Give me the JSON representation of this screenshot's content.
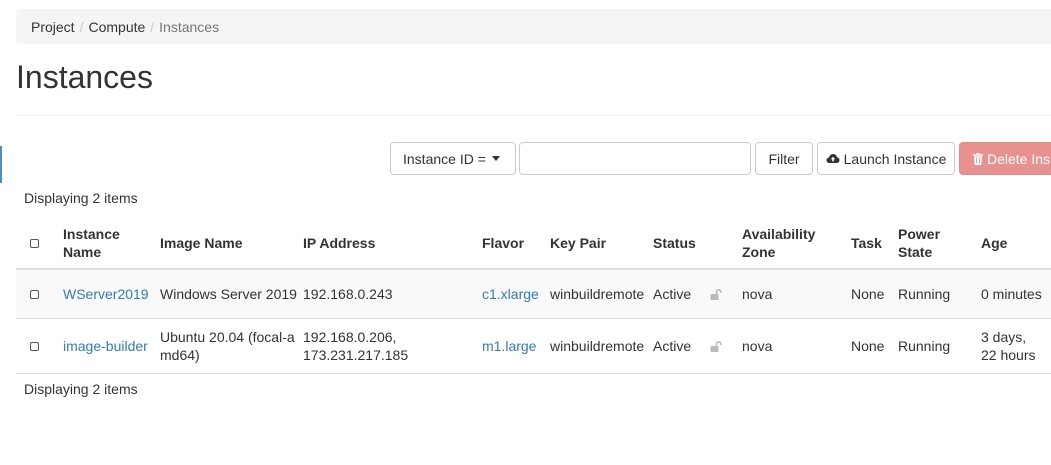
{
  "breadcrumb": {
    "items": [
      "Project",
      "Compute"
    ],
    "separator": "/",
    "current": "Instances"
  },
  "page": {
    "title": "Instances"
  },
  "toolbar": {
    "filter_select_label": "Instance ID =",
    "filter_input_value": "",
    "filter_button": "Filter",
    "launch_button": "Launch Instance",
    "delete_button": "Delete Ins"
  },
  "table": {
    "count_label": "Displaying 2 items",
    "headers": {
      "instance_name": [
        "Instance",
        "Name"
      ],
      "image_name": "Image Name",
      "ip_address": "IP Address",
      "flavor": "Flavor",
      "key_pair": "Key Pair",
      "status": "Status",
      "availability_zone": [
        "Availability",
        "Zone"
      ],
      "task": "Task",
      "power_state": [
        "Power",
        "State"
      ],
      "age": "Age"
    },
    "rows": [
      {
        "instance_name": "WServer2019",
        "image_name": [
          "Windows Server 2019"
        ],
        "ip_address": [
          "192.168.0.243"
        ],
        "flavor": "c1.xlarge",
        "key_pair": "winbuildremote",
        "status": "Active",
        "availability_zone": "nova",
        "task": "None",
        "power_state": "Running",
        "age": [
          "0 minutes"
        ]
      },
      {
        "instance_name": "image-builder",
        "image_name": [
          "Ubuntu 20.04 (focal-a",
          "md64)"
        ],
        "ip_address": [
          "192.168.0.206,",
          "173.231.217.185"
        ],
        "flavor": "m1.large",
        "key_pair": "winbuildremote",
        "status": "Active",
        "availability_zone": "nova",
        "task": "None",
        "power_state": "Running",
        "age": [
          "3 days,",
          "22 hours"
        ]
      }
    ]
  },
  "colors": {
    "link": "#337ab7",
    "danger_button": "#e79290",
    "breadcrumb_bg": "#f5f5f5",
    "row_stripe": "#f9f9f9"
  },
  "icons": {
    "launch": "cloud-upload-icon",
    "delete": "trash-icon",
    "lock": "unlock-icon",
    "filter_caret": "caret-down-icon"
  }
}
